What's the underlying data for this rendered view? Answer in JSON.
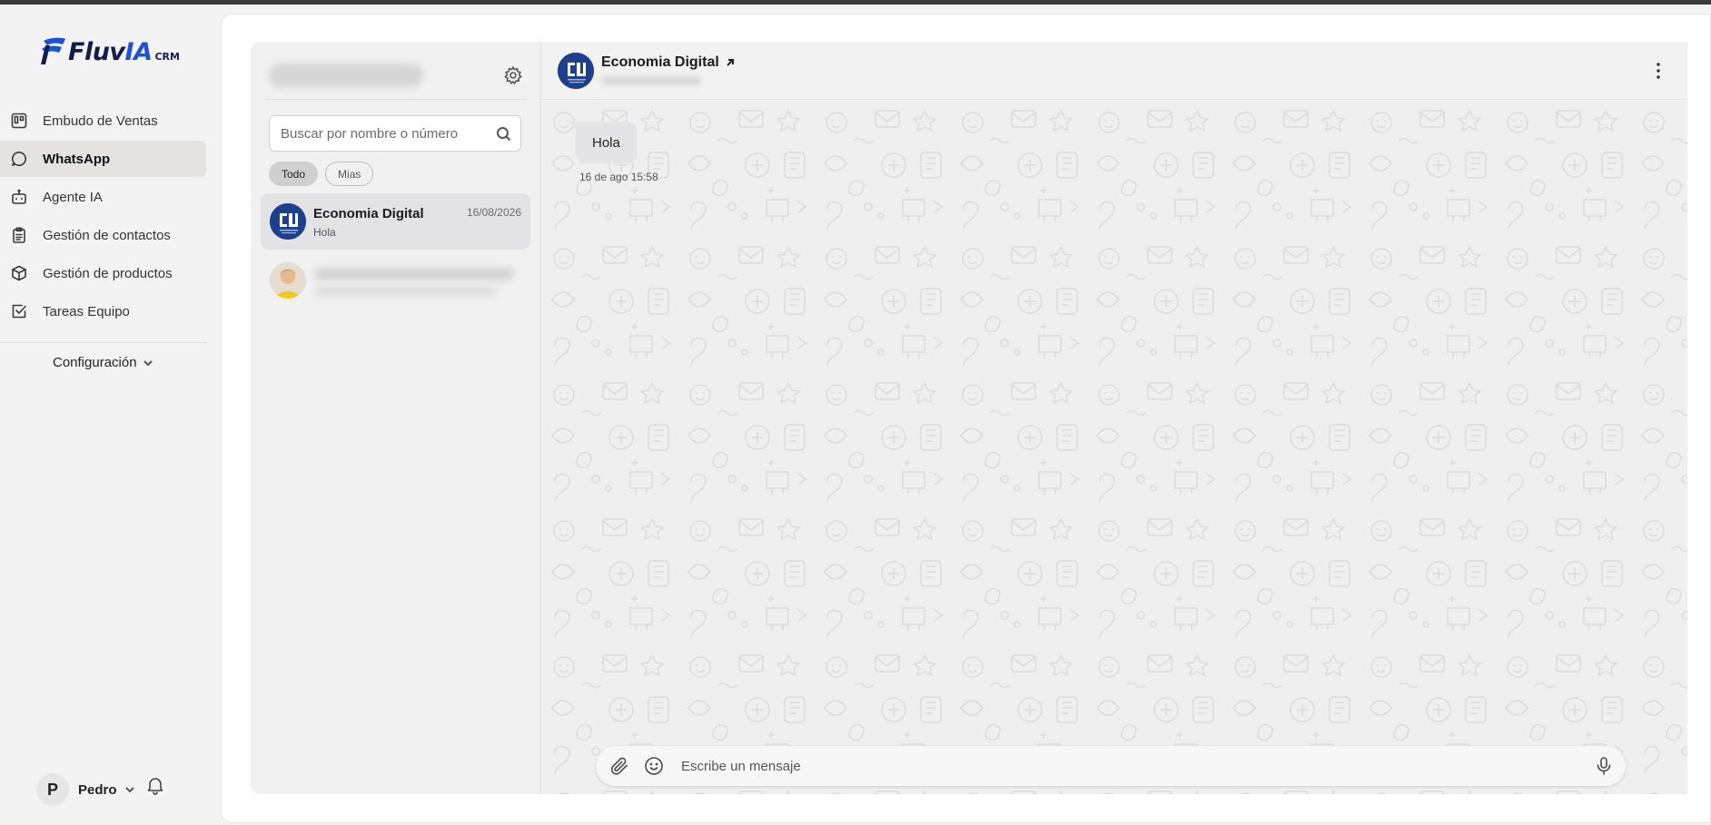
{
  "brand": {
    "logo_main": "Fluv",
    "logo_accent": "IA",
    "logo_suffix": "CRM",
    "primary_color": "#1d52d6",
    "dark_color": "#141c4a"
  },
  "sidebar": {
    "items": [
      {
        "label": "Embudo de Ventas",
        "icon": "kanban-icon",
        "active": false
      },
      {
        "label": "WhatsApp",
        "icon": "chat-bubble-icon",
        "active": true
      },
      {
        "label": "Agente IA",
        "icon": "robot-icon",
        "active": false
      },
      {
        "label": "Gestión de contactos",
        "icon": "clipboard-icon",
        "active": false
      },
      {
        "label": "Gestión de productos",
        "icon": "box-icon",
        "active": false
      },
      {
        "label": "Tareas Equipo",
        "icon": "checkbox-icon",
        "active": false
      }
    ],
    "config_label": "Configuración",
    "user": {
      "initial": "P",
      "name": "Pedro"
    }
  },
  "chatlist": {
    "search_placeholder": "Buscar por nombre o número",
    "filters": [
      {
        "label": "Todo",
        "active": true
      },
      {
        "label": "Mias",
        "active": false
      }
    ],
    "conversations": [
      {
        "name": "Economia Digital",
        "date": "16/08/2026",
        "preview": "Hola",
        "active": true
      }
    ]
  },
  "chat": {
    "contact_name": "Economia Digital",
    "messages": [
      {
        "text": "Hola",
        "time": "16 de ago 15:58",
        "direction": "incoming"
      }
    ],
    "composer_placeholder": "Escribe un mensaje"
  }
}
